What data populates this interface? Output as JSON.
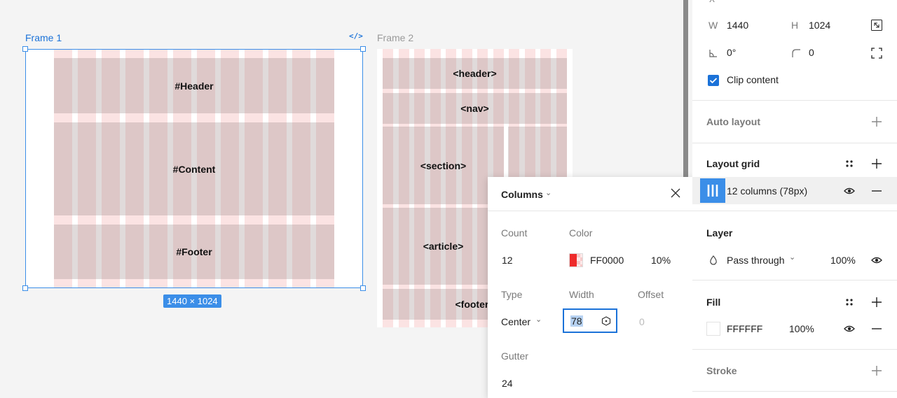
{
  "canvas": {
    "frame1": {
      "label": "Frame 1",
      "code_icon": "</>",
      "size_badge": "1440 × 1024",
      "regions": {
        "header": "#Header",
        "content": "#Content",
        "footer": "#Footer"
      }
    },
    "frame2": {
      "label": "Frame 2",
      "regions": {
        "header": "<header>",
        "nav": "<nav>",
        "section": "<section>",
        "article": "<article>",
        "footer": "<footer>"
      }
    },
    "grid_color": "#fbe3e3"
  },
  "popup": {
    "title": "Columns",
    "count_label": "Count",
    "count_value": "12",
    "color_label": "Color",
    "color_hex": "FF0000",
    "color_opacity": "10%",
    "type_label": "Type",
    "type_value": "Center",
    "width_label": "Width",
    "width_value": "78",
    "offset_label": "Offset",
    "offset_value": "0",
    "gutter_label": "Gutter",
    "gutter_value": "24"
  },
  "panel": {
    "w_label": "W",
    "w_value": "1440",
    "h_label": "H",
    "h_value": "1024",
    "rotation_value": "0°",
    "radius_value": "0",
    "clip_content_label": "Clip content",
    "clip_content_checked": true,
    "auto_layout_title": "Auto layout",
    "layout_grid_title": "Layout grid",
    "grid_item_label": "12 columns (78px)",
    "layer_title": "Layer",
    "blend_mode": "Pass through",
    "layer_opacity": "100%",
    "fill_title": "Fill",
    "fill_hex": "FFFFFF",
    "fill_opacity": "100%",
    "stroke_title": "Stroke",
    "accent": "#1b72d8",
    "selection_color": "#3b8ee8"
  }
}
